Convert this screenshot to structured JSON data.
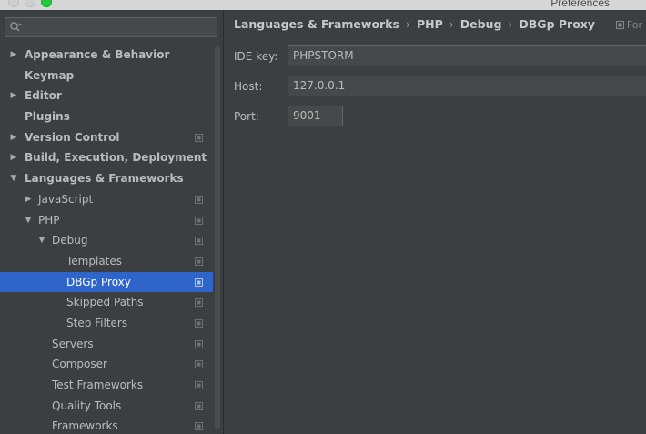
{
  "window": {
    "title": "Preferences"
  },
  "search": {
    "placeholder": "",
    "icon": "search-icon"
  },
  "tree": [
    {
      "label": "Appearance & Behavior",
      "bold": true,
      "arrow": "collapsed",
      "indent": 0,
      "project": false,
      "selected": false,
      "name": "tree-item-appearance-behavior"
    },
    {
      "label": "Keymap",
      "bold": true,
      "arrow": "none",
      "indent": 0,
      "project": false,
      "selected": false,
      "name": "tree-item-keymap"
    },
    {
      "label": "Editor",
      "bold": true,
      "arrow": "collapsed",
      "indent": 0,
      "project": false,
      "selected": false,
      "name": "tree-item-editor"
    },
    {
      "label": "Plugins",
      "bold": true,
      "arrow": "none",
      "indent": 0,
      "project": false,
      "selected": false,
      "name": "tree-item-plugins"
    },
    {
      "label": "Version Control",
      "bold": true,
      "arrow": "collapsed",
      "indent": 0,
      "project": true,
      "selected": false,
      "name": "tree-item-version-control"
    },
    {
      "label": "Build, Execution, Deployment",
      "bold": true,
      "arrow": "collapsed",
      "indent": 0,
      "project": false,
      "selected": false,
      "name": "tree-item-build-execution-deployment"
    },
    {
      "label": "Languages & Frameworks",
      "bold": true,
      "arrow": "expanded",
      "indent": 0,
      "project": false,
      "selected": false,
      "name": "tree-item-languages-frameworks"
    },
    {
      "label": "JavaScript",
      "bold": false,
      "arrow": "collapsed",
      "indent": 1,
      "project": true,
      "selected": false,
      "name": "tree-item-javascript"
    },
    {
      "label": "PHP",
      "bold": false,
      "arrow": "expanded",
      "indent": 1,
      "project": true,
      "selected": false,
      "name": "tree-item-php"
    },
    {
      "label": "Debug",
      "bold": false,
      "arrow": "expanded",
      "indent": 2,
      "project": true,
      "selected": false,
      "name": "tree-item-debug"
    },
    {
      "label": "Templates",
      "bold": false,
      "arrow": "none",
      "indent": 3,
      "project": true,
      "selected": false,
      "name": "tree-item-templates"
    },
    {
      "label": "DBGp Proxy",
      "bold": false,
      "arrow": "none",
      "indent": 3,
      "project": true,
      "selected": true,
      "name": "tree-item-dbgp-proxy"
    },
    {
      "label": "Skipped Paths",
      "bold": false,
      "arrow": "none",
      "indent": 3,
      "project": true,
      "selected": false,
      "name": "tree-item-skipped-paths"
    },
    {
      "label": "Step Filters",
      "bold": false,
      "arrow": "none",
      "indent": 3,
      "project": true,
      "selected": false,
      "name": "tree-item-step-filters"
    },
    {
      "label": "Servers",
      "bold": false,
      "arrow": "none",
      "indent": 2,
      "project": true,
      "selected": false,
      "name": "tree-item-servers"
    },
    {
      "label": "Composer",
      "bold": false,
      "arrow": "none",
      "indent": 2,
      "project": true,
      "selected": false,
      "name": "tree-item-composer"
    },
    {
      "label": "Test Frameworks",
      "bold": false,
      "arrow": "none",
      "indent": 2,
      "project": true,
      "selected": false,
      "name": "tree-item-test-frameworks"
    },
    {
      "label": "Quality Tools",
      "bold": false,
      "arrow": "none",
      "indent": 2,
      "project": true,
      "selected": false,
      "name": "tree-item-quality-tools"
    },
    {
      "label": "Frameworks",
      "bold": false,
      "arrow": "none",
      "indent": 2,
      "project": true,
      "selected": false,
      "name": "tree-item-frameworks"
    }
  ],
  "breadcrumb": {
    "items": [
      "Languages & Frameworks",
      "PHP",
      "Debug",
      "DBGp Proxy"
    ],
    "separator": "›"
  },
  "scope": {
    "label": "For"
  },
  "form": {
    "ide_key": {
      "label": "IDE key:",
      "value": "PHPSTORM"
    },
    "host": {
      "label": "Host:",
      "value": "127.0.0.1"
    },
    "port": {
      "label": "Port:",
      "value": "9001"
    }
  },
  "colors": {
    "selection": "#2f65ca",
    "panel": "#3c3f41",
    "input_bg": "#45494a",
    "text": "#bbbbbb"
  }
}
